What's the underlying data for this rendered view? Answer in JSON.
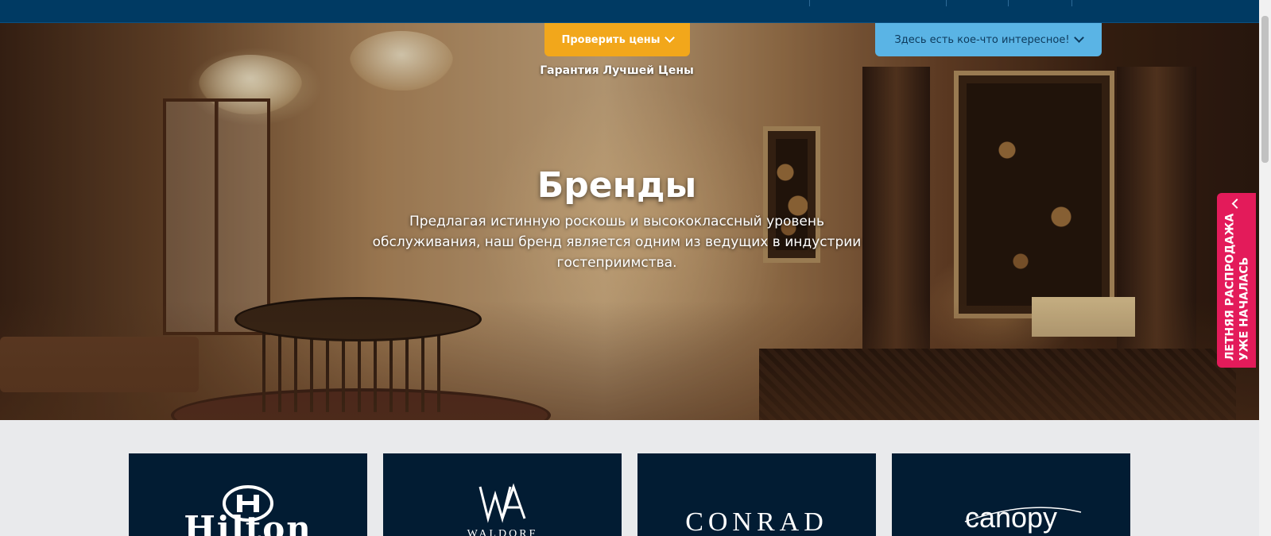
{
  "cta": {
    "prices_label": "Проверить цены",
    "interest_label": "Здесь есть кое-что интересное!",
    "guarantee": "Гарантия Лучшей Цены"
  },
  "hero": {
    "title": "Бренды",
    "description": "Предлагая истинную роскошь и высококлассный уровень обслуживания, наш бренд является одним из ведущих в индустрии гостеприимства."
  },
  "promo": {
    "line1": "ЛЕТНЯЯ РАСПРОДАЖА",
    "line2": "УЖЕ НАЧАЛАСЬ"
  },
  "brands": [
    {
      "name": "Hilton",
      "logo": "hilton-logo"
    },
    {
      "name": "WALDORF",
      "logo": "waldorf-astoria-logo"
    },
    {
      "name": "CONRAD",
      "logo": "conrad-logo"
    },
    {
      "name": "canopy",
      "logo": "canopy-logo"
    }
  ],
  "colors": {
    "nav_bg": "#003a63",
    "prices_button": "#f2a71b",
    "interest_button": "#5ab4e5",
    "promo_tab": "#e31b5a",
    "card_bg": "#021c33",
    "page_bg": "#e9eaec"
  },
  "icons": [
    "chevron-down-icon",
    "chevron-up-icon"
  ]
}
